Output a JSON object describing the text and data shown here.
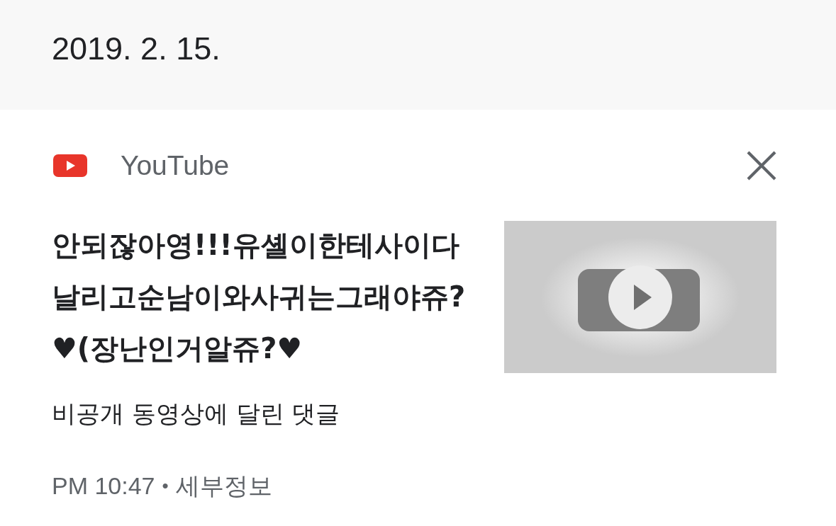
{
  "date_header": {
    "date": "2019. 2. 15."
  },
  "notification": {
    "app_name": "YouTube",
    "title": "안되잖아영!!!유셸이한테사이다날리고순남이와사귀는그래야쥬?♥(장난인거알쥬?♥",
    "subtitle": "비공개 동영상에 달린 댓글",
    "time": "PM 10:47",
    "separator": "•",
    "details": "세부정보"
  }
}
